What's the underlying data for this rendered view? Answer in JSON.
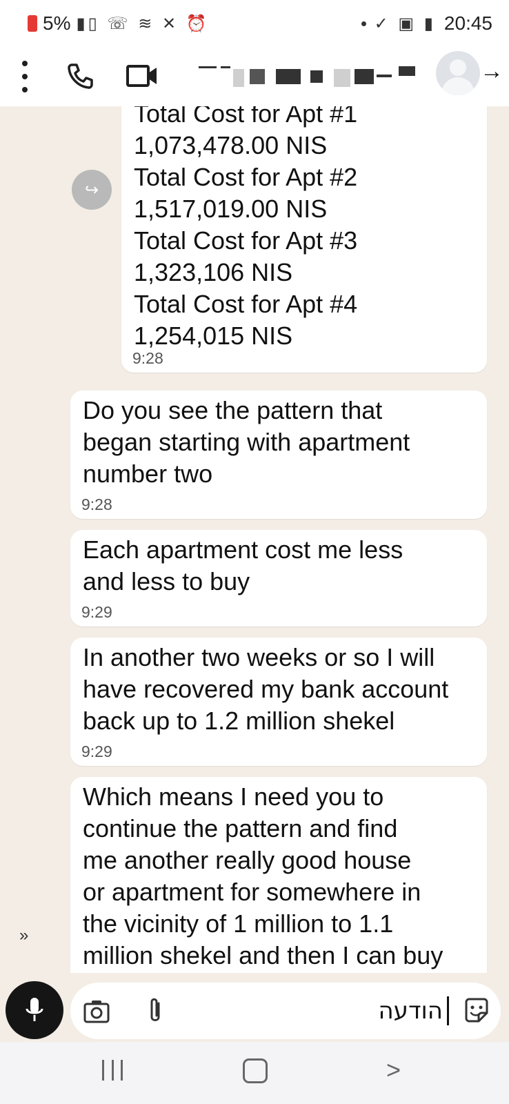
{
  "status_bar": {
    "battery": "5%",
    "time": "20:45"
  },
  "header": {
    "more_icon": "more-vertical-icon",
    "call_icon": "phone-icon",
    "video_icon": "video-camera-icon",
    "back_icon": "arrow-right-icon"
  },
  "messages": [
    {
      "text": "Total Cost for Apt #1\n1,073,478.00 NIS\nTotal Cost for Apt #2\n1,517,019.00 NIS\nTotal Cost for Apt #3\n1,323,106 NIS\nTotal Cost for Apt #4\n1,254,015 NIS",
      "time": "9:28"
    },
    {
      "text": "Do you see the pattern that\nbegan starting with apartment\nnumber two",
      "time": "9:28"
    },
    {
      "text": "Each apartment cost me less\nand less to buy",
      "time": "9:29"
    },
    {
      "text": "In another two weeks or so I will\nhave recovered my bank account\nback up to 1.2 million shekel",
      "time": "9:29"
    },
    {
      "text": "Which means I need you to\ncontinue the pattern and find\nme another really good house\nor apartment for somewhere in\nthe vicinity of 1 million to 1.1\nmillion shekel and then I can buy",
      "time": ""
    }
  ],
  "composer": {
    "input_value": "הודעה",
    "mic_icon": "microphone-icon",
    "camera_icon": "camera-icon",
    "attach_icon": "paperclip-icon",
    "sticker_icon": "sticker-icon"
  },
  "colors": {
    "chat_background": "#f3ede5",
    "bubble": "#ffffff",
    "mic_button": "#151515"
  }
}
